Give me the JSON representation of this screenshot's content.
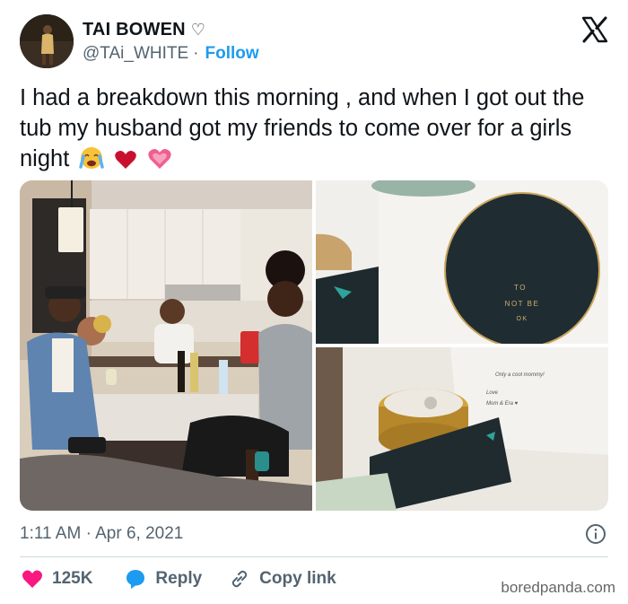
{
  "author": {
    "name": "TAI BOWEN",
    "name_suffix_icon": "heart-outline-icon",
    "handle": "@TAi_WHITE",
    "separator": "·",
    "follow_label": "Follow"
  },
  "platform_logo": "x-logo-icon",
  "tweet": {
    "text": "I had a breakdown this morning , and when I got out the tub my husband got my friends to come over for a girls night",
    "emojis": [
      "crying-face-emoji",
      "red-heart-emoji",
      "sparkling-heart-emoji"
    ]
  },
  "media": {
    "card_text_lines": [
      "TO",
      "NOT BE",
      "OK"
    ],
    "note_lines": [
      "Only a cool mommy!",
      "Love",
      "Mom & Era ♥"
    ]
  },
  "meta": {
    "timestamp": "1:11 AM · Apr 6, 2021"
  },
  "actions": {
    "like_count": "125K",
    "reply_label": "Reply",
    "copy_link_label": "Copy link"
  },
  "watermark": "boredpanda.com",
  "colors": {
    "accent": "#1d9bf0",
    "like": "#f91880",
    "text": "#0f1419",
    "muted": "#536471"
  }
}
